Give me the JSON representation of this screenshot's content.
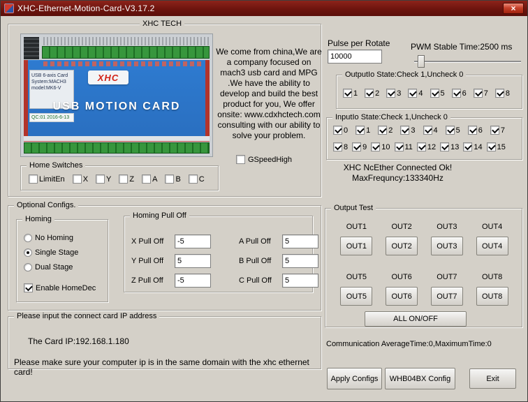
{
  "window": {
    "title": "XHC-Ethernet-Motion-Card-V3.17.2",
    "close_glyph": "×"
  },
  "tech": {
    "legend": "XHC TECH",
    "about": "We come from china,We are a company focused on mach3 usb card and  MPG .We have the ability to develop and build the best product for you, We offer onsite: www.cdxhctech.com consulting with our ability to solve your problem.",
    "gspeed_label": "GSpeedHigh",
    "gspeed_checked": false,
    "card": {
      "logo": "XHC",
      "title": "USB MOTION CARD",
      "sticker_lines": [
        "USB 6-axis Card",
        "System:MACH3",
        "model:MK6-V"
      ],
      "qc": "QC:01   2016-6-13"
    },
    "home_switches": {
      "legend": "Home Switches",
      "items": [
        {
          "label": "LimitEn",
          "checked": false
        },
        {
          "label": "X",
          "checked": false
        },
        {
          "label": "Y",
          "checked": false
        },
        {
          "label": "Z",
          "checked": false
        },
        {
          "label": "A",
          "checked": false
        },
        {
          "label": "B",
          "checked": false
        },
        {
          "label": "C",
          "checked": false
        }
      ]
    }
  },
  "pulse": {
    "label": "Pulse per Rotate",
    "value": "10000"
  },
  "pwm": {
    "label": "PWM Stable Time:2500 ms"
  },
  "output_io": {
    "legend": "OutputIo State:Check 1,Uncheck 0",
    "items": [
      {
        "label": "1",
        "checked": true
      },
      {
        "label": "2",
        "checked": true
      },
      {
        "label": "3",
        "checked": true
      },
      {
        "label": "4",
        "checked": true
      },
      {
        "label": "5",
        "checked": true
      },
      {
        "label": "6",
        "checked": true
      },
      {
        "label": "7",
        "checked": true
      },
      {
        "label": "8",
        "checked": true
      }
    ]
  },
  "input_io": {
    "legend": "InputIo State:Check 1,Uncheck 0",
    "row1": [
      {
        "label": "0",
        "checked": true
      },
      {
        "label": "1",
        "checked": true
      },
      {
        "label": "2",
        "checked": true
      },
      {
        "label": "3",
        "checked": true
      },
      {
        "label": "4",
        "checked": true
      },
      {
        "label": "5",
        "checked": true
      },
      {
        "label": "6",
        "checked": true
      },
      {
        "label": "7",
        "checked": true
      }
    ],
    "row2": [
      {
        "label": "8",
        "checked": true
      },
      {
        "label": "9",
        "checked": true
      },
      {
        "label": "10",
        "checked": true
      },
      {
        "label": "11",
        "checked": true
      },
      {
        "label": "12",
        "checked": true
      },
      {
        "label": "13",
        "checked": true
      },
      {
        "label": "14",
        "checked": true
      },
      {
        "label": "15",
        "checked": true
      }
    ]
  },
  "status": {
    "line1": "XHC NcEther Connected Ok!",
    "line2": "MaxFrequncy:133340Hz"
  },
  "optional": {
    "legend": "Optional Configs.",
    "homing": {
      "legend": "Homing",
      "options": [
        {
          "label": "No Homing",
          "selected": false
        },
        {
          "label": "Single Stage",
          "selected": true
        },
        {
          "label": "Dual Stage",
          "selected": false
        }
      ],
      "homedec": {
        "label": "Enable HomeDec",
        "checked": true
      }
    },
    "pull_off": {
      "legend": "Homing Pull Off",
      "left": [
        {
          "label": "X Pull Off",
          "value": "-5"
        },
        {
          "label": "Y Pull Off",
          "value": "5"
        },
        {
          "label": "Z Pull Off",
          "value": "-5"
        }
      ],
      "right": [
        {
          "label": "A Pull Off",
          "value": "5"
        },
        {
          "label": "B Pull Off",
          "value": "5"
        },
        {
          "label": "C Pull Off",
          "value": "5"
        }
      ]
    }
  },
  "ip_box": {
    "legend": "Please input the connect card IP address",
    "card_ip": "The Card IP:192.168.1.180",
    "note": "Please make sure your computer ip is in the same domain with the xhc ethernet card!"
  },
  "output_test": {
    "legend": "Output Test",
    "row1": [
      "OUT1",
      "OUT2",
      "OUT3",
      "OUT4"
    ],
    "row2": [
      "OUT5",
      "OUT6",
      "OUT7",
      "OUT8"
    ],
    "all_label": "ALL ON/OFF"
  },
  "footer": {
    "comm": "Communication AverageTime:0,MaximumTime:0",
    "apply": "Apply Configs",
    "whb": "WHB04BX Config",
    "exit": "Exit"
  }
}
